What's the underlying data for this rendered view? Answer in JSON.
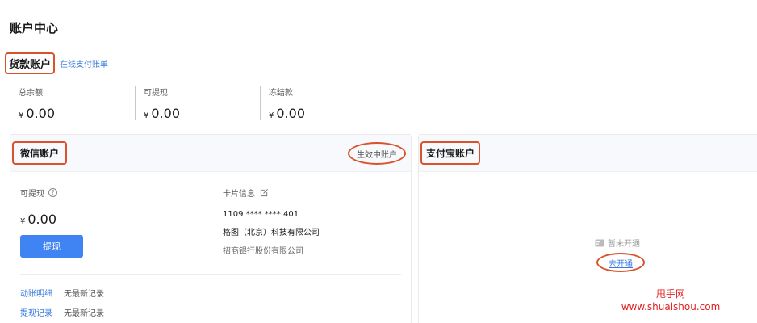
{
  "page": {
    "title": "账户中心"
  },
  "goods_account": {
    "title": "货款账户",
    "link_label": "在线支付账单",
    "stats": [
      {
        "label": "总余额",
        "currency": "¥",
        "value": "0.00"
      },
      {
        "label": "可提现",
        "currency": "¥",
        "value": "0.00"
      },
      {
        "label": "冻结款",
        "currency": "¥",
        "value": "0.00"
      }
    ]
  },
  "wechat": {
    "title": "微信账户",
    "status": "生效中账户",
    "withdrawable_label": "可提现",
    "currency": "¥",
    "balance": "0.00",
    "withdraw_button": "提现",
    "card_info_label": "卡片信息",
    "card_number": "1109 **** **** 401",
    "company": "格图（北京）科技有限公司",
    "bank": "招商银行股份有限公司",
    "records": [
      {
        "label": "动账明细",
        "value": "无最新记录"
      },
      {
        "label": "提现记录",
        "value": "无最新记录"
      }
    ]
  },
  "alipay": {
    "title": "支付宝账户",
    "not_open_text": "暂未开通",
    "open_link": "去开通"
  },
  "watermark": {
    "line1": "甩手网",
    "line2": "www.shuaishou.com"
  },
  "colors": {
    "accent": "#3f84f2",
    "link": "#3a7be0",
    "highlight": "#d9522b",
    "watermark": "#e02020"
  }
}
